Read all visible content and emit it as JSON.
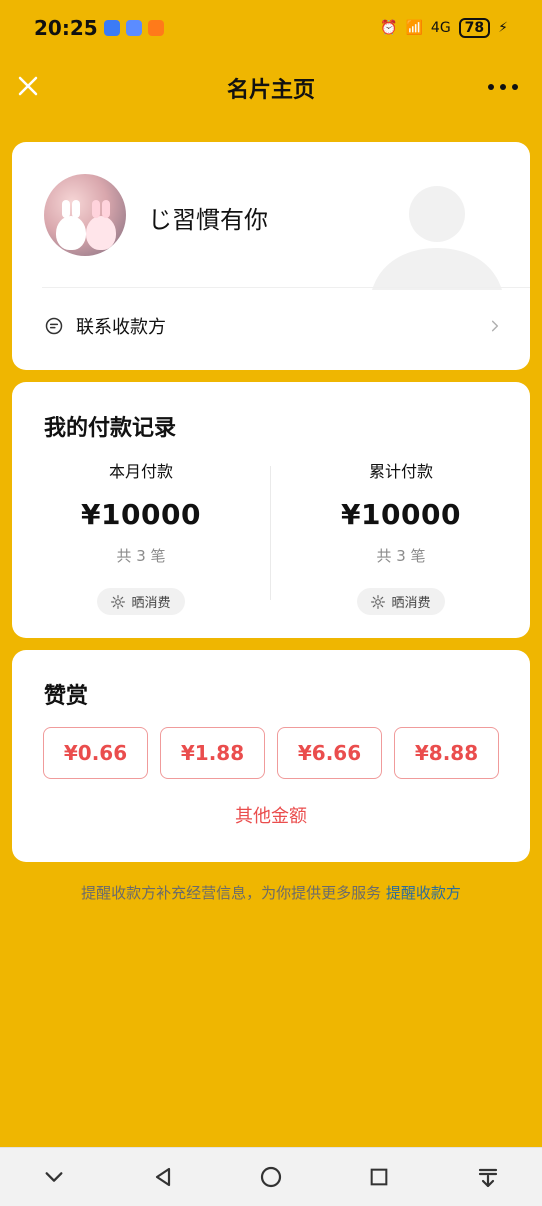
{
  "status": {
    "time": "20:25",
    "battery": "78"
  },
  "header": {
    "title": "名片主页"
  },
  "profile": {
    "name": "じ習慣有你",
    "contact_label": "联系收款方"
  },
  "records": {
    "title": "我的付款记录",
    "month": {
      "label": "本月付款",
      "amount": "¥10000",
      "count": "共 3 笔",
      "chip": "晒消费"
    },
    "total": {
      "label": "累计付款",
      "amount": "¥10000",
      "count": "共 3 笔",
      "chip": "晒消费"
    }
  },
  "tips": {
    "title": "赞赏",
    "options": [
      "¥0.66",
      "¥1.88",
      "¥6.66",
      "¥8.88"
    ],
    "other": "其他金额"
  },
  "footer": {
    "text": "提醒收款方补充经营信息，为你提供更多服务",
    "link": "提醒收款方"
  }
}
